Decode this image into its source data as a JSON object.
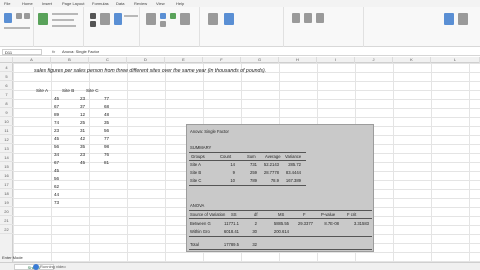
{
  "ribbon": {
    "tabs": [
      "File",
      "Home",
      "Insert",
      "Page Layout",
      "Formulas",
      "Data",
      "Review",
      "View",
      "Help"
    ]
  },
  "formula_bar": {
    "name_box": "D11",
    "fx": "fx",
    "value": "Anova: Single Factor"
  },
  "columns": [
    "A",
    "B",
    "C",
    "D",
    "E",
    "F",
    "G",
    "H",
    "I",
    "J",
    "K",
    "L"
  ],
  "rows": [
    "4",
    "5",
    "6",
    "7",
    "8",
    "9",
    "10",
    "11",
    "12",
    "13",
    "14",
    "15",
    "16",
    "17",
    "18",
    "19",
    "20",
    "21",
    "22"
  ],
  "intro": "sales figures per sales person from three different sites over the same year (in thousands of pounds).",
  "table": {
    "headers": [
      "Site A",
      "Site B",
      "Site C"
    ],
    "site_a": [
      "45",
      "67",
      "89",
      "74",
      "23",
      "45",
      "56",
      "34",
      "67",
      "45",
      "56",
      "62",
      "44",
      "73"
    ],
    "site_b": [
      "23",
      "37",
      "12",
      "25",
      "31",
      "42",
      "35",
      "23",
      "45"
    ],
    "site_c": [
      "77",
      "68",
      "48",
      "35",
      "56",
      "77",
      "98",
      "76",
      "81"
    ]
  },
  "anova": {
    "title": "Anova: Single Factor",
    "summary_label": "SUMMARY",
    "summary_headers": [
      "Groups",
      "Count",
      "Sum",
      "Average",
      "Variance"
    ],
    "summary_rows": [
      {
        "group": "Site A",
        "count": "14",
        "sum": "731",
        "average": "52.2143",
        "variance": "285.72"
      },
      {
        "group": "Site B",
        "count": "9",
        "sum": "259",
        "average": "28.7778",
        "variance": "83.4444"
      },
      {
        "group": "Site C",
        "count": "10",
        "sum": "789",
        "average": "78.9",
        "variance": "167.389"
      }
    ],
    "anova_label": "ANOVA",
    "anova_headers": [
      "Source of Variation",
      "SS",
      "df",
      "MS",
      "F",
      "P-value",
      "F crit"
    ],
    "anova_rows": [
      {
        "source": "Between G",
        "ss": "11771.1",
        "df": "2",
        "ms": "5885.55",
        "f": "29.3377",
        "p": "8.7E-08",
        "fcrit": "3.31583"
      },
      {
        "source": "Within Gro",
        "ss": "6018.41",
        "df": "30",
        "ms": "200.614",
        "f": "",
        "p": "",
        "fcrit": ""
      }
    ],
    "total_row": {
      "source": "Total",
      "ss": "17789.5",
      "df": "32"
    }
  },
  "status": {
    "sheet_tab": "Sheet1",
    "left_text": "Enter Mode",
    "video_label": "Running video"
  },
  "colors": {
    "excel_green": "#217346",
    "anova_bg": "#c9c9c9"
  }
}
